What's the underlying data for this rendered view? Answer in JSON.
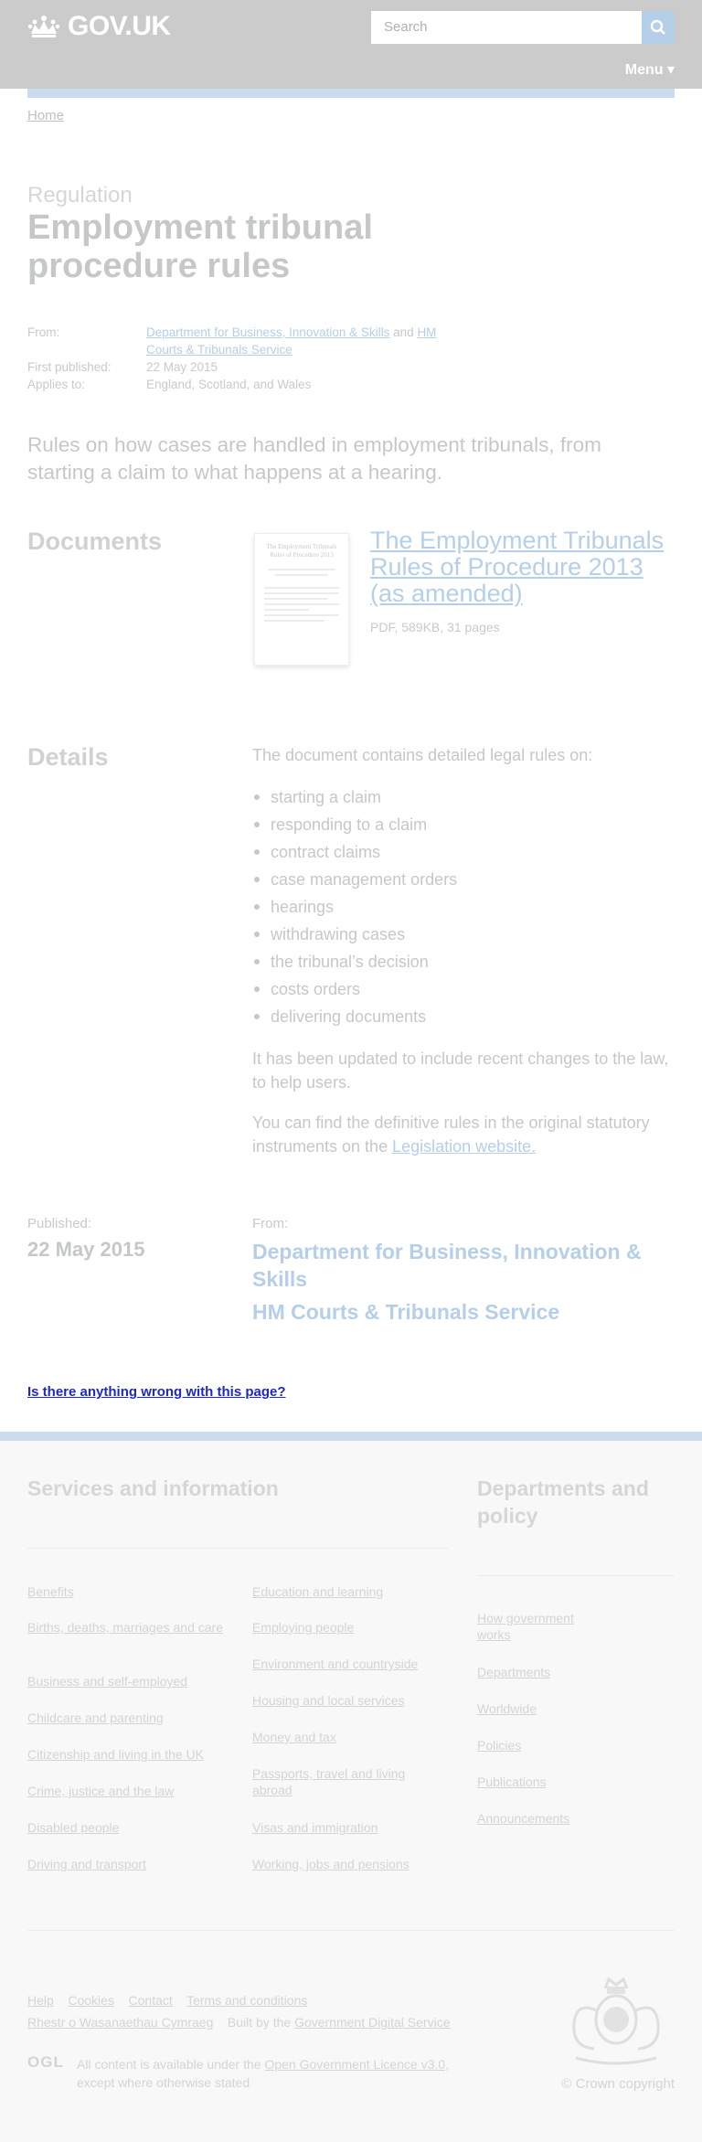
{
  "header": {
    "logo_text": "GOV.UK",
    "search_placeholder": "Search",
    "menu_label": "Menu ▾"
  },
  "breadcrumb": {
    "home": "Home"
  },
  "page": {
    "caption": "Regulation",
    "title": "Employment tribunal procedure rules",
    "meta": {
      "from_label": "From:",
      "from_org_1": "Department for Business, Innovation & Skills",
      "from_and": "and",
      "from_org_2": "HM Courts & Tribunals Service",
      "first_published_label": "First published:",
      "first_published": "22 May 2015",
      "applies_label": "Applies to:",
      "applies_to": "England, Scotland, and Wales"
    },
    "lead": "Rules on how cases are handled in employment tribunals, from starting a claim to what happens at a hearing."
  },
  "documents": {
    "heading": "Documents",
    "thumbnail_title": "The Employment Tribunals Rules of Procedure 2013",
    "item_title": "The Employment Tribunals Rules of Procedure 2013 (as amended)",
    "item_meta": "PDF, 589KB, 31 pages"
  },
  "details": {
    "heading": "Details",
    "intro": "The document contains detailed legal rules on:",
    "items": [
      "starting a claim",
      "responding to a claim",
      "contract claims",
      "case management orders",
      "hearings",
      "withdrawing cases",
      "the tribunal’s decision",
      "costs orders",
      "delivering documents"
    ],
    "para1": "It has been updated to include recent changes to the law, to help users.",
    "para2_text": "You can find the definitive rules in the original statutory instruments on the",
    "para2_link": "Legislation website."
  },
  "published": {
    "published_label": "Published:",
    "date": "22 May 2015",
    "from_label": "From:",
    "org_1": "Department for Business, Innovation & Skills",
    "org_2": "HM Courts & Tribunals Service"
  },
  "report_link": "Is there anything wrong with this page?",
  "footer": {
    "services_heading": "Services and information",
    "departments_heading": "Departments and policy",
    "services_col1": [
      "Benefits",
      "Births, deaths, marriages and care",
      "Business and self-employed",
      "Childcare and parenting",
      "Citizenship and living in the UK",
      "Crime, justice and the law",
      "Disabled people",
      "Driving and transport"
    ],
    "services_col2": [
      "Education and learning",
      "Employing people",
      "Environment and countryside",
      "Housing and local services",
      "Money and tax",
      "Passports, travel and living abroad",
      "Visas and immigration",
      "Working, jobs and pensions"
    ],
    "departments": [
      "How government works",
      "Departments",
      "Worldwide",
      "Policies",
      "Publications",
      "Announcements"
    ],
    "bottom_links": [
      "Help",
      "Cookies",
      "Contact",
      "Terms and conditions",
      "Rhestr o Wasanaethau Cymraeg"
    ],
    "built_by_text": "Built by the",
    "built_by_link": "Government Digital Service",
    "ogl_logo": "OGL",
    "licence_text_1": "All content is available under the",
    "licence_link": "Open Government Licence v3.0,",
    "licence_text_2": "except where otherwise stated",
    "copyright": "© Crown copyright"
  }
}
